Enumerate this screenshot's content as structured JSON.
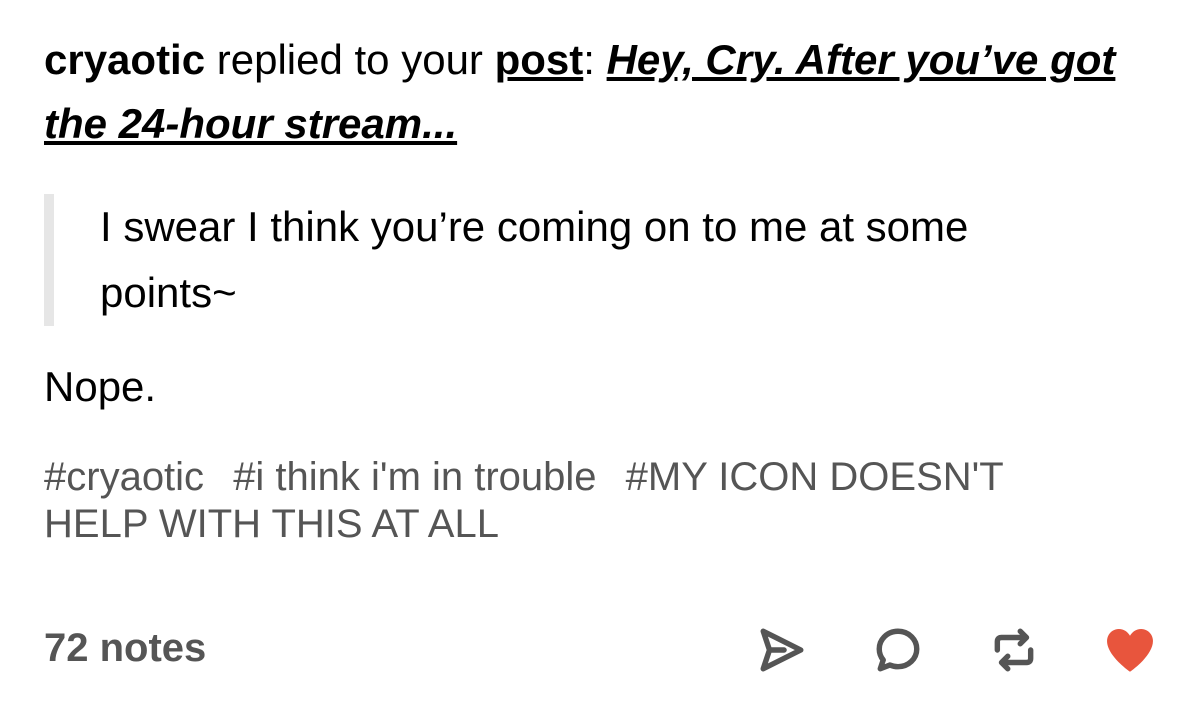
{
  "header": {
    "username": "cryaotic",
    "replied_text": " replied to your ",
    "post_label": "post",
    "colon": ": ",
    "post_title": "Hey, Cry. After you’ve got the 24-hour stream..."
  },
  "quote": {
    "text": "I swear I think you’re coming on to me at some points~"
  },
  "reply": {
    "text": "Nope."
  },
  "tags": [
    "#cryaotic",
    "#i think i'm in trouble",
    "#MY ICON DOESN'T HELP WITH THIS AT ALL"
  ],
  "footer": {
    "notes": "72 notes",
    "icons": [
      "share-icon",
      "comment-icon",
      "reblog-icon",
      "like-icon"
    ],
    "like_color": "#e8553d",
    "icon_color": "#555555"
  }
}
